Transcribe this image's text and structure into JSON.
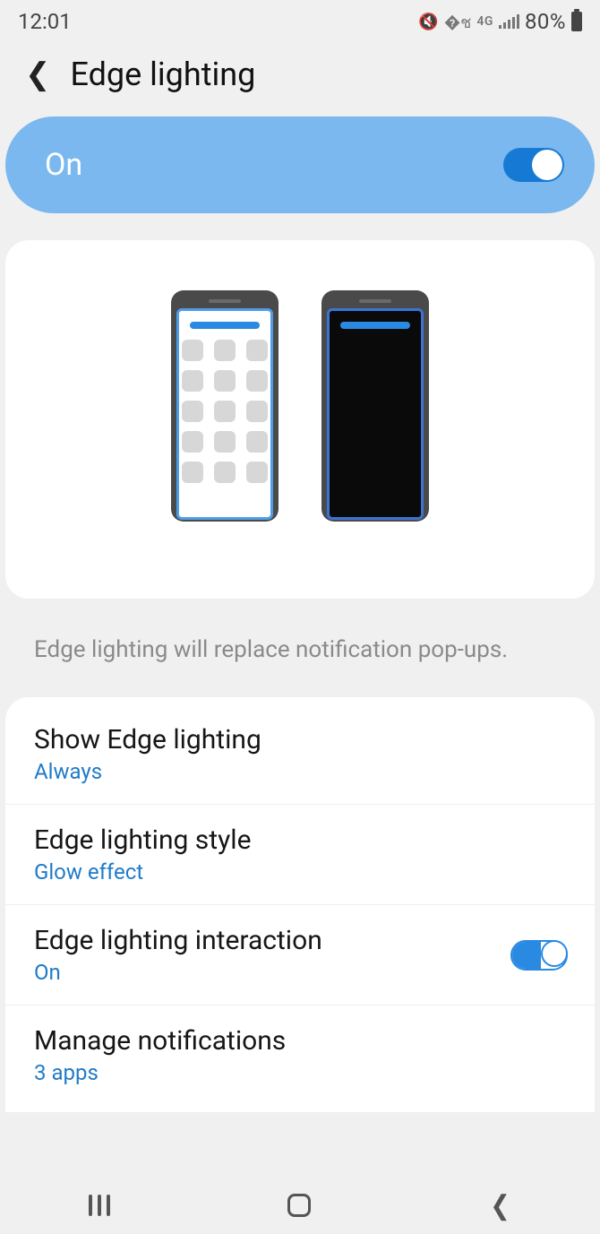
{
  "status": {
    "time": "12:01",
    "network": "4G",
    "battery": "80%"
  },
  "header": {
    "title": "Edge lighting"
  },
  "master": {
    "label": "On",
    "enabled": true
  },
  "description": "Edge lighting will replace notification pop-ups.",
  "settings": {
    "show": {
      "title": "Show Edge lighting",
      "value": "Always"
    },
    "style": {
      "title": "Edge lighting style",
      "value": "Glow effect"
    },
    "interaction": {
      "title": "Edge lighting interaction",
      "value": "On",
      "enabled": true
    },
    "manage": {
      "title": "Manage notifications",
      "value": "3 apps"
    }
  }
}
